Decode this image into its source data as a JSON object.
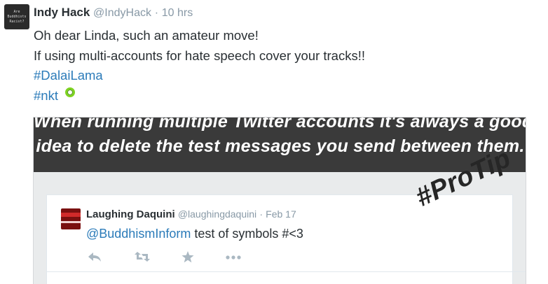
{
  "tweet": {
    "avatar_text": [
      "Are",
      "Buddhists",
      "Racist?"
    ],
    "name": "Indy Hack",
    "handle": "@IndyHack",
    "separator": "·",
    "time": "10 hrs",
    "lines": [
      "Oh dear Linda, such an amateur move!",
      "If using multi-accounts for hate speech cover your tracks!!"
    ],
    "hashtags": [
      "#DalaiLama",
      "#nkt"
    ]
  },
  "embedded_image": {
    "banner_lines": [
      "When running multiple Twitter accounts it's always a good",
      "idea to delete the test messages you send between them."
    ],
    "inner_tweet": {
      "name": "Laughing Daquini",
      "handle": "@laughingdaquini",
      "separator": "·",
      "date": "Feb 17",
      "mention": "@BuddhismInform",
      "text": " test of symbols #<3",
      "actions": [
        "reply-icon",
        "retweet-icon",
        "favorite-icon",
        "more-icon"
      ]
    },
    "protip": "#ProTip"
  },
  "colors": {
    "link": "#2b7bb9",
    "muted": "#8899a6",
    "banner": "#3a3a3a",
    "accent_dot": "#7ed321"
  }
}
